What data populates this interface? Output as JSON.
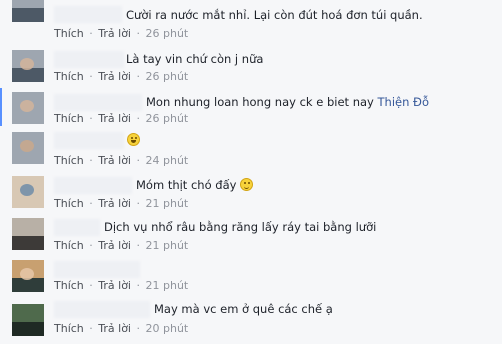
{
  "action_labels": {
    "like": "Thích",
    "reply": "Trả lời",
    "separator": "·"
  },
  "comments": [
    {
      "text": "Cười ra nước mắt nhỉ. Lại còn đút hoá đơn túi quần.",
      "time": "26 phút"
    },
    {
      "text": "Là tay vin chứ còn j nữa",
      "time": "26 phút"
    },
    {
      "text": "Mon nhung loan hong nay ck e biet nay",
      "mention": "Thiện Đỗ",
      "time": "26 phút"
    },
    {
      "text": "",
      "emoji": "tears-of-joy",
      "time": "24 phút"
    },
    {
      "text": "Móm thịt chó đấy",
      "emoji": "smile",
      "time": "21 phút"
    },
    {
      "text": "Dịch vụ nhổ râu bằng răng lấy ráy tai bằng lưỡi",
      "time": "21 phút"
    },
    {
      "text": "",
      "time": "21 phút"
    },
    {
      "text": "May mà vc em ở quê các chế ạ",
      "time": "20 phút"
    }
  ],
  "colors": {
    "background": "#f6f7f9",
    "text": "#1d2129",
    "meta": "#90949c",
    "mention": "#365899",
    "reply_bar": "#5890ff"
  }
}
